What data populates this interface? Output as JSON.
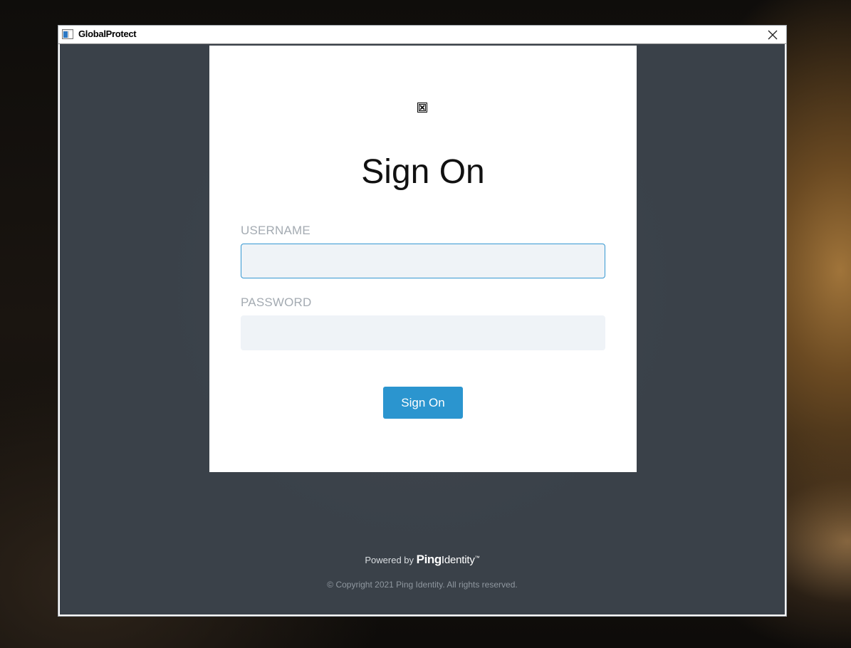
{
  "window": {
    "title": "GlobalProtect"
  },
  "form": {
    "title": "Sign On",
    "username_label": "USERNAME",
    "username_value": "",
    "password_label": "PASSWORD",
    "password_value": "",
    "submit_label": "Sign On"
  },
  "footer": {
    "powered_prefix": "Powered by",
    "brand_ping": "Ping",
    "brand_identity": "Identity",
    "brand_tm": "™",
    "copyright": "© Copyright 2021 Ping Identity. All rights reserved."
  },
  "colors": {
    "accent": "#2b95cf",
    "focus_border": "#3598d2",
    "background": "#3d444c",
    "input_bg": "#eff3f7",
    "label": "#a4abb2"
  },
  "icons": {
    "app": "globalprotect-app-icon",
    "close": "close-icon",
    "logo": "broken-image-icon"
  }
}
